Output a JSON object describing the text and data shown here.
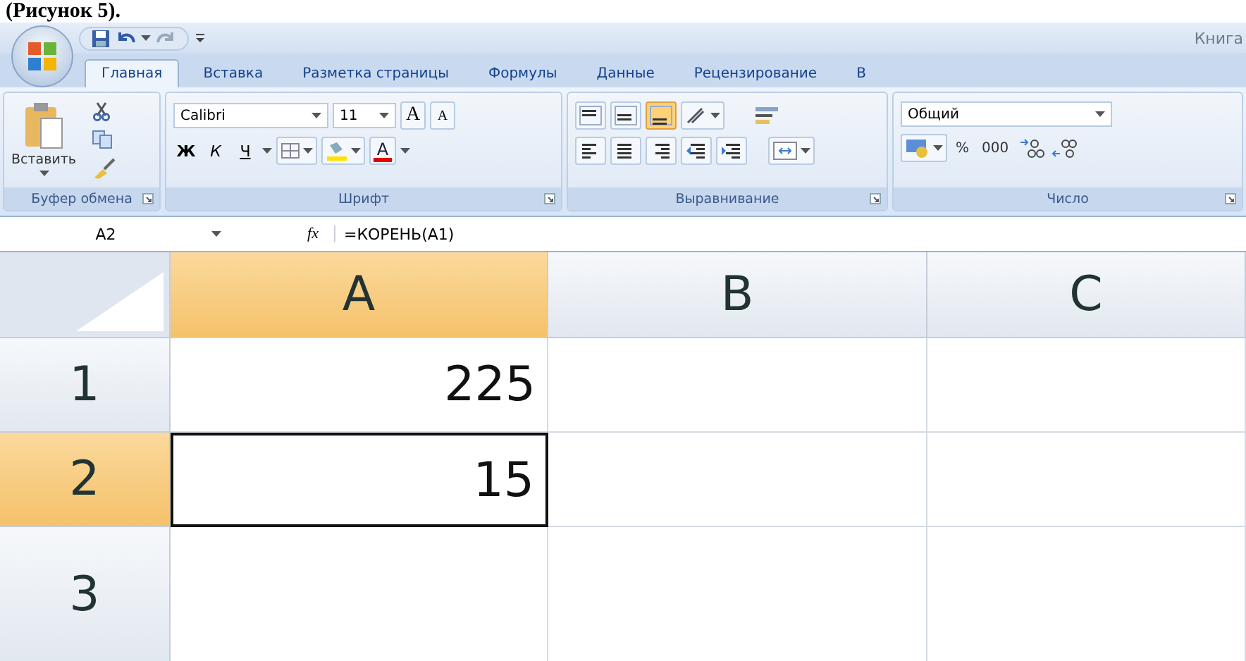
{
  "caption": "(Рисунок 5).",
  "title": "Книга",
  "tabs": [
    {
      "label": "Главная",
      "selected": true
    },
    {
      "label": "Вставка",
      "selected": false
    },
    {
      "label": "Разметка страницы",
      "selected": false
    },
    {
      "label": "Формулы",
      "selected": false
    },
    {
      "label": "Данные",
      "selected": false
    },
    {
      "label": "Рецензирование",
      "selected": false
    },
    {
      "label": "В",
      "selected": false
    }
  ],
  "clipboard": {
    "paste": "Вставить",
    "label": "Буфер обмена"
  },
  "font": {
    "family": "Calibri",
    "size": "11",
    "grow": "A",
    "shrink": "A",
    "styles": [
      "Ж",
      "К",
      "Ч"
    ],
    "color_letter": "A",
    "label": "Шрифт"
  },
  "alignment": {
    "vertical": [
      {
        "selected": false
      },
      {
        "selected": false
      },
      {
        "selected": true
      }
    ],
    "label": "Выравнивание"
  },
  "number": {
    "format": "Общий",
    "percent": "%",
    "thousands": "000",
    "label": "Число"
  },
  "formula_bar": {
    "name_box": "A2",
    "fx": "fx",
    "formula": "=КОРЕНЬ(A1)"
  },
  "columns": [
    {
      "label": "A",
      "selected": true
    },
    {
      "label": "B",
      "selected": false
    },
    {
      "label": "C",
      "selected": false
    }
  ],
  "rows": [
    {
      "header": "1",
      "selected": false,
      "value": "225"
    },
    {
      "header": "2",
      "selected": true,
      "value": "15"
    },
    {
      "header": "3",
      "selected": false
    }
  ]
}
